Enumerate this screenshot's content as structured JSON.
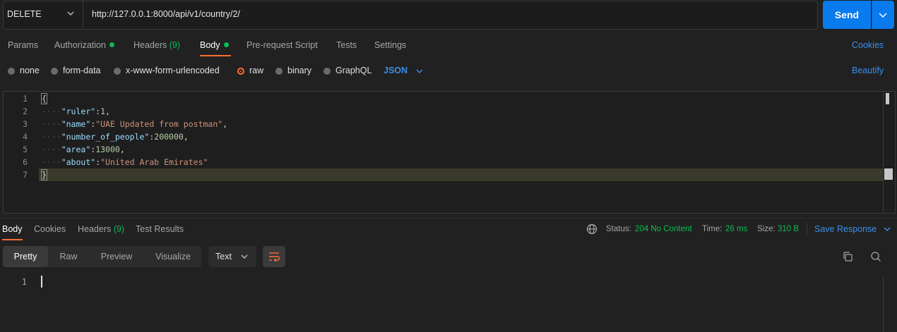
{
  "request": {
    "method": "DELETE",
    "url": "http://127.0.0.1:8000/api/v1/country/2/",
    "send_label": "Send"
  },
  "request_tabs": [
    {
      "label": "Params"
    },
    {
      "label": "Authorization"
    },
    {
      "label": "Headers",
      "count": "(9)"
    },
    {
      "label": "Body"
    },
    {
      "label": "Pre-request Script"
    },
    {
      "label": "Tests"
    },
    {
      "label": "Settings"
    }
  ],
  "cookies_label": "Cookies",
  "body_types": [
    "none",
    "form-data",
    "x-www-form-urlencoded",
    "raw",
    "binary",
    "GraphQL"
  ],
  "selected_body_type": "raw",
  "format": "JSON",
  "beautify_label": "Beautify",
  "editor": {
    "line_numbers": [
      "1",
      "2",
      "3",
      "4",
      "5",
      "6",
      "7"
    ],
    "open_brace": "{",
    "close_brace": "}",
    "fields": [
      {
        "key": "\"ruler\"",
        "value": "1",
        "value_type": "number",
        "suffix": ","
      },
      {
        "key": "\"name\"",
        "value": "\"UAE Updated from postman\"",
        "value_type": "string",
        "suffix": ","
      },
      {
        "key": "\"number_of_people\"",
        "value": "200000",
        "value_type": "number",
        "suffix": ","
      },
      {
        "key": "\"area\"",
        "value": "13000",
        "value_type": "number",
        "suffix": ","
      },
      {
        "key": "\"about\"",
        "value": "\"United Arab Emirates\"",
        "value_type": "string",
        "suffix": ""
      }
    ]
  },
  "response_tabs": [
    {
      "label": "Body"
    },
    {
      "label": "Cookies"
    },
    {
      "label": "Headers",
      "count": "(9)"
    },
    {
      "label": "Test Results"
    }
  ],
  "status": {
    "status_label": "Status:",
    "status_value": "204 No Content",
    "time_label": "Time:",
    "time_value": "26 ms",
    "size_label": "Size:",
    "size_value": "310 B"
  },
  "save_response_label": "Save Response",
  "view_modes": [
    "Pretty",
    "Raw",
    "Preview",
    "Visualize"
  ],
  "response_format": "Text",
  "response_line_numbers": [
    "1"
  ],
  "colors": {
    "accent": "#ff6c37",
    "primary": "#097bed",
    "link": "#3b8eea",
    "success": "#0cbb52",
    "background": "#212121"
  },
  "icons": [
    "chevron-down-icon",
    "globe-icon",
    "wrap-lines-icon",
    "copy-icon",
    "search-icon"
  ]
}
